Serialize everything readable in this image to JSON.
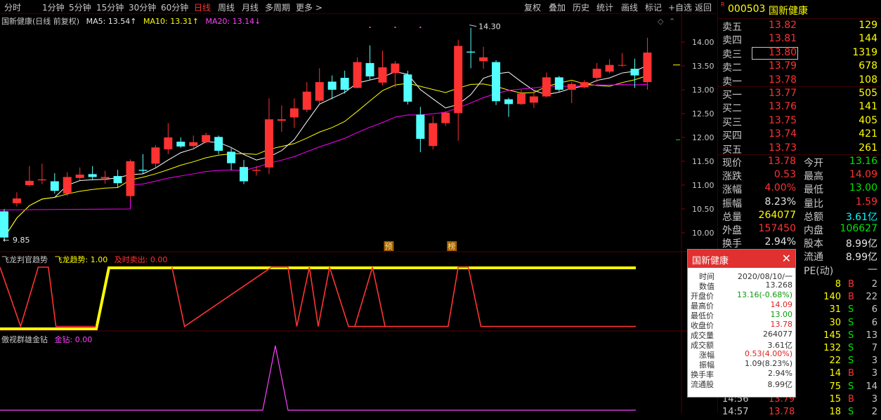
{
  "periods": [
    {
      "label": "分时",
      "active": false
    },
    {
      "label": "1分钟",
      "active": false
    },
    {
      "label": "5分钟",
      "active": false
    },
    {
      "label": "15分钟",
      "active": false
    },
    {
      "label": "30分钟",
      "active": false
    },
    {
      "label": "60分钟",
      "active": false
    },
    {
      "label": "日线",
      "active": true
    },
    {
      "label": "周线",
      "active": false
    },
    {
      "label": "月线",
      "active": false
    },
    {
      "label": "多周期",
      "active": false
    },
    {
      "label": "更多 >",
      "active": false
    }
  ],
  "tools": [
    "复权",
    "叠加",
    "历史",
    "统计",
    "画线",
    "标记",
    "+自选",
    "返回"
  ],
  "chart_title": "国新健康(日线 前复权)",
  "ma": {
    "ma5": "MA5: 13.54↑",
    "ma10": "MA10: 13.31↑",
    "ma20": "MA20: 13.14↓"
  },
  "colors": {
    "up": "#ff3232",
    "down": "#54ffff",
    "ma5": "#ffffff",
    "ma10": "#ffff00",
    "ma20": "#ff00ff",
    "accent": "#ff3232"
  },
  "annotations": {
    "high_label": "14.30",
    "low_label": "9.85",
    "badge1": "预",
    "badge2": "榜"
  },
  "indicator1": {
    "name": "飞龙判官趋势",
    "series1": "飞龙趋势: 1.00",
    "series2": "及时卖出: 0.00"
  },
  "indicator2": {
    "name": "傲视群雄金钻",
    "series1": "金钻: 0.00"
  },
  "chart_data": {
    "type": "candlestick",
    "ylim": [
      9.85,
      14.3
    ],
    "yticks": [
      "14.00",
      "13.50",
      "13.00",
      "12.50",
      "12.00",
      "11.50",
      "11.00",
      "10.50",
      "10.00"
    ],
    "candles": [
      {
        "o": 10.45,
        "c": 9.9,
        "h": 10.5,
        "l": 9.85
      },
      {
        "o": 10.62,
        "c": 10.72,
        "h": 10.85,
        "l": 10.55
      },
      {
        "o": 11.0,
        "c": 11.09,
        "h": 11.4,
        "l": 10.97
      },
      {
        "o": 11.1,
        "c": 11.12,
        "h": 11.45,
        "l": 11.02
      },
      {
        "o": 11.08,
        "c": 10.88,
        "h": 11.25,
        "l": 10.82
      },
      {
        "o": 10.82,
        "c": 11.17,
        "h": 11.27,
        "l": 10.77
      },
      {
        "o": 11.15,
        "c": 11.22,
        "h": 11.37,
        "l": 11.1
      },
      {
        "o": 11.23,
        "c": 11.17,
        "h": 11.4,
        "l": 11.1
      },
      {
        "o": 11.14,
        "c": 11.17,
        "h": 11.3,
        "l": 11.03
      },
      {
        "o": 11.19,
        "c": 11.04,
        "h": 11.32,
        "l": 10.94
      },
      {
        "o": 10.77,
        "c": 11.5,
        "h": 11.54,
        "l": 10.7
      },
      {
        "o": 11.32,
        "c": 11.3,
        "h": 11.65,
        "l": 11.24
      },
      {
        "o": 11.45,
        "c": 11.79,
        "h": 11.84,
        "l": 11.37
      },
      {
        "o": 11.75,
        "c": 12.0,
        "h": 12.3,
        "l": 11.65
      },
      {
        "o": 11.91,
        "c": 11.81,
        "h": 12.0,
        "l": 11.78
      },
      {
        "o": 11.82,
        "c": 11.9,
        "h": 12.04,
        "l": 11.78
      },
      {
        "o": 11.9,
        "c": 12.05,
        "h": 12.1,
        "l": 11.88
      },
      {
        "o": 12.01,
        "c": 11.72,
        "h": 12.04,
        "l": 11.65
      },
      {
        "o": 11.7,
        "c": 11.46,
        "h": 11.77,
        "l": 11.32
      },
      {
        "o": 11.38,
        "c": 11.08,
        "h": 11.53,
        "l": 11.02
      },
      {
        "o": 11.3,
        "c": 11.32,
        "h": 11.4,
        "l": 11.2
      },
      {
        "o": 11.37,
        "c": 12.38,
        "h": 12.82,
        "l": 11.23
      },
      {
        "o": 12.35,
        "c": 12.38,
        "h": 12.67,
        "l": 12.12
      },
      {
        "o": 12.42,
        "c": 12.61,
        "h": 12.82,
        "l": 12.2
      },
      {
        "o": 12.58,
        "c": 12.96,
        "h": 13.16,
        "l": 12.53
      },
      {
        "o": 12.77,
        "c": 13.16,
        "h": 13.45,
        "l": 12.7
      },
      {
        "o": 13.17,
        "c": 13.0,
        "h": 13.3,
        "l": 12.8
      },
      {
        "o": 13.25,
        "c": 13.0,
        "h": 13.4,
        "l": 12.92
      },
      {
        "o": 13.04,
        "c": 13.58,
        "h": 13.68,
        "l": 13.03
      },
      {
        "o": 13.56,
        "c": 13.28,
        "h": 13.93,
        "l": 13.2
      },
      {
        "o": 13.15,
        "c": 13.47,
        "h": 13.82,
        "l": 13.09
      },
      {
        "o": 13.35,
        "c": 13.55,
        "h": 13.6,
        "l": 13.05
      },
      {
        "o": 13.32,
        "c": 12.75,
        "h": 13.4,
        "l": 12.69
      },
      {
        "o": 12.48,
        "c": 11.97,
        "h": 12.64,
        "l": 11.69
      },
      {
        "o": 11.82,
        "c": 12.3,
        "h": 12.45,
        "l": 11.75
      },
      {
        "o": 12.3,
        "c": 12.52,
        "h": 12.55,
        "l": 12.24
      },
      {
        "o": 12.51,
        "c": 13.92,
        "h": 14.05,
        "l": 11.93
      },
      {
        "o": 13.8,
        "c": 13.78,
        "h": 14.3,
        "l": 13.45
      },
      {
        "o": 13.6,
        "c": 13.68,
        "h": 13.9,
        "l": 13.44
      },
      {
        "o": 13.58,
        "c": 12.76,
        "h": 13.62,
        "l": 12.68
      },
      {
        "o": 12.8,
        "c": 12.7,
        "h": 12.83,
        "l": 12.43
      },
      {
        "o": 12.7,
        "c": 12.92,
        "h": 13.0,
        "l": 12.68
      },
      {
        "o": 12.73,
        "c": 12.86,
        "h": 12.98,
        "l": 12.62
      },
      {
        "o": 12.86,
        "c": 13.26,
        "h": 13.36,
        "l": 12.84
      },
      {
        "o": 13.26,
        "c": 13.0,
        "h": 13.29,
        "l": 12.96
      },
      {
        "o": 13.0,
        "c": 13.12,
        "h": 13.17,
        "l": 12.72
      },
      {
        "o": 13.05,
        "c": 13.16,
        "h": 13.2,
        "l": 13.03
      },
      {
        "o": 13.25,
        "c": 13.44,
        "h": 13.56,
        "l": 13.16
      },
      {
        "o": 13.38,
        "c": 13.52,
        "h": 13.64,
        "l": 13.34
      },
      {
        "o": 13.52,
        "c": 13.52,
        "h": 13.77,
        "l": 13.48
      },
      {
        "o": 13.44,
        "c": 13.3,
        "h": 13.65,
        "l": 13.04
      },
      {
        "o": 13.16,
        "c": 13.78,
        "h": 14.09,
        "l": 13.0
      }
    ]
  },
  "indicator_data": {
    "trend": [
      0,
      0,
      0,
      0,
      0,
      0,
      0,
      0,
      0,
      0,
      1,
      1,
      1,
      1,
      1,
      1,
      1,
      1,
      1,
      1,
      1,
      1,
      1,
      1,
      1,
      1,
      1,
      1,
      1,
      1,
      1,
      1,
      1,
      1,
      1,
      1,
      1,
      1,
      1,
      1,
      1,
      1,
      1,
      1,
      1,
      1,
      1,
      1,
      1,
      1,
      1,
      1
    ],
    "sell": [
      1,
      1,
      0,
      1,
      0,
      1,
      1,
      1,
      1,
      1,
      1,
      1,
      1,
      1,
      1,
      1,
      1,
      1,
      1,
      1,
      1,
      1,
      1,
      1,
      1,
      1,
      1,
      1,
      1,
      1,
      1,
      1,
      1,
      1,
      1,
      1,
      1,
      1,
      1,
      1,
      1,
      1,
      1,
      1,
      1,
      1,
      1,
      1,
      1,
      1,
      1,
      1
    ],
    "sellseg": [
      [
        0,
        1
      ],
      [
        1,
        0.05
      ],
      [
        2,
        1
      ],
      [
        3,
        0.05
      ],
      [
        4,
        1
      ],
      [
        4.5,
        1
      ],
      [
        10,
        1
      ],
      [
        16.5,
        1
      ],
      [
        18,
        0.05
      ],
      [
        26,
        0.05
      ],
      [
        27.5,
        1
      ],
      [
        30,
        1
      ],
      [
        31.5,
        0.05
      ],
      [
        33,
        1
      ],
      [
        33.5,
        1
      ],
      [
        34.5,
        0.05
      ],
      [
        36,
        1
      ],
      [
        37,
        0.05
      ],
      [
        38,
        0.05
      ],
      [
        39,
        1
      ],
      [
        41.5,
        1
      ],
      [
        43.5,
        0.05
      ],
      [
        50,
        0.05
      ]
    ],
    "diamond_peak_index": 21.5
  },
  "quote": {
    "code": "000503",
    "name": "国新健康",
    "asks": [
      {
        "label": "卖五",
        "price": "13.82",
        "vol": "129"
      },
      {
        "label": "卖四",
        "price": "13.81",
        "vol": "144"
      },
      {
        "label": "卖三",
        "price": "13.80",
        "vol": "1319"
      },
      {
        "label": "卖二",
        "price": "13.79",
        "vol": "678"
      },
      {
        "label": "卖一",
        "price": "13.78",
        "vol": "108"
      }
    ],
    "bids": [
      {
        "label": "买一",
        "price": "13.77",
        "vol": "505"
      },
      {
        "label": "买二",
        "price": "13.76",
        "vol": "141"
      },
      {
        "label": "买三",
        "price": "13.75",
        "vol": "405"
      },
      {
        "label": "买四",
        "price": "13.74",
        "vol": "421"
      },
      {
        "label": "买五",
        "price": "13.73",
        "vol": "261"
      }
    ],
    "stats": [
      {
        "k1": "现价",
        "v1": "13.78",
        "c1": "red",
        "k2": "今开",
        "v2": "13.16",
        "c2": "green"
      },
      {
        "k1": "涨跌",
        "v1": "0.53",
        "c1": "red",
        "k2": "最高",
        "v2": "14.09",
        "c2": "red"
      },
      {
        "k1": "涨幅",
        "v1": "4.00%",
        "c1": "red",
        "k2": "最低",
        "v2": "13.00",
        "c2": "green"
      },
      {
        "k1": "振幅",
        "v1": "8.23%",
        "c1": "white",
        "k2": "量比",
        "v2": "1.59",
        "c2": "red"
      },
      {
        "k1": "总量",
        "v1": "264077",
        "c1": "yellow",
        "k2": "总额",
        "v2": "3.61亿",
        "c2": "cyan"
      },
      {
        "k1": "外盘",
        "v1": "157450",
        "c1": "red",
        "k2": "内盘",
        "v2": "106627",
        "c2": "green"
      },
      {
        "k1": "换手",
        "v1": "2.94%",
        "c1": "white",
        "k2": "股本",
        "v2": "8.99亿",
        "c2": "white"
      },
      {
        "k1": "",
        "v1": "",
        "c1": "white",
        "k2": "流通",
        "v2": "8.99亿",
        "c2": "white"
      },
      {
        "k1": "",
        "v1": "",
        "c1": "white",
        "k2": "PE(动)",
        "v2": "—",
        "c2": "white"
      }
    ],
    "ticks": [
      {
        "time": "",
        "price": "",
        "vol": "8",
        "side": "B",
        "n": "2"
      },
      {
        "time": "",
        "price": "",
        "vol": "140",
        "side": "B",
        "n": "22"
      },
      {
        "time": "",
        "price": "",
        "vol": "31",
        "side": "S",
        "n": "6"
      },
      {
        "time": "",
        "price": "",
        "vol": "30",
        "side": "S",
        "n": "6"
      },
      {
        "time": "",
        "price": "",
        "vol": "145",
        "side": "S",
        "n": "13"
      },
      {
        "time": "",
        "price": "",
        "vol": "132",
        "side": "S",
        "n": "7"
      },
      {
        "time": "",
        "price": "",
        "vol": "22",
        "side": "S",
        "n": "3"
      },
      {
        "time": "",
        "price": "",
        "vol": "14",
        "side": "B",
        "n": "3"
      },
      {
        "time": "",
        "price": "",
        "vol": "75",
        "side": "S",
        "n": "14"
      },
      {
        "time": "14:56",
        "price": "13.79",
        "vol": "15",
        "side": "B",
        "n": "3"
      },
      {
        "time": "14:57",
        "price": "13.78",
        "vol": "18",
        "side": "S",
        "n": "2"
      }
    ]
  },
  "popup": {
    "title": "国新健康",
    "rows": [
      {
        "k": "时间",
        "v": "2020/08/10/一",
        "c": "#333"
      },
      {
        "k": "数值",
        "v": "13.268",
        "c": "#333"
      },
      {
        "k": "开盘价",
        "v": "13.16(-0.68%)",
        "c": "#0a9a0a"
      },
      {
        "k": "最高价",
        "v": "14.09",
        "c": "#e02020"
      },
      {
        "k": "最低价",
        "v": "13.00",
        "c": "#0a9a0a"
      },
      {
        "k": "收盘价",
        "v": "13.78",
        "c": "#e02020"
      },
      {
        "k": "成交量",
        "v": "264077",
        "c": "#333"
      },
      {
        "k": "成交额",
        "v": "3.61亿",
        "c": "#333"
      },
      {
        "k": "涨幅",
        "v": "0.53(4.00%)",
        "c": "#e02020"
      },
      {
        "k": "振幅",
        "v": "1.09(8.23%)",
        "c": "#333"
      },
      {
        "k": "换手率",
        "v": "2.94%",
        "c": "#333"
      },
      {
        "k": "流通股",
        "v": "8.99亿",
        "c": "#333"
      }
    ]
  }
}
